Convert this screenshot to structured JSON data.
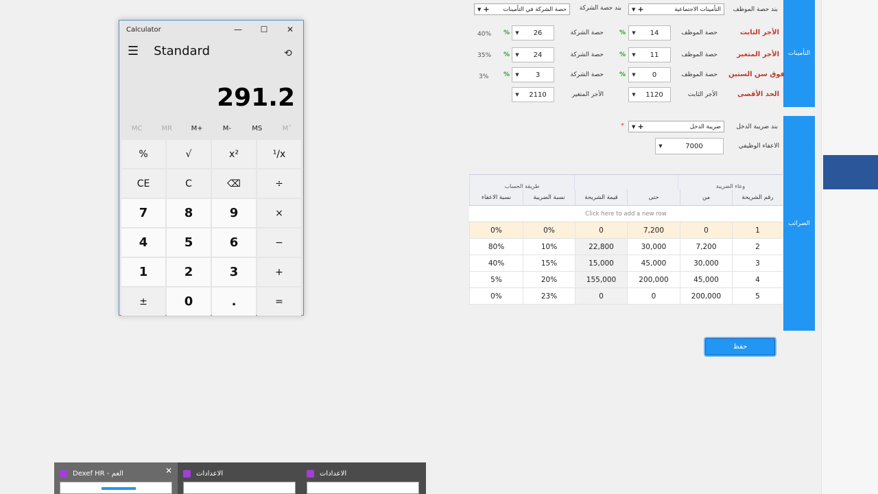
{
  "calculator": {
    "window_title": "Calculator",
    "mode": "Standard",
    "display": "291.2",
    "memory": [
      "MC",
      "MR",
      "M+",
      "M-",
      "MS",
      "M˅"
    ],
    "keys": [
      "%",
      "√",
      "x²",
      "¹/x",
      "CE",
      "C",
      "⌫",
      "÷",
      "7",
      "8",
      "9",
      "×",
      "4",
      "5",
      "6",
      "−",
      "1",
      "2",
      "3",
      "+",
      "±",
      "0",
      ".",
      "="
    ]
  },
  "insurance": {
    "section_label": "التأمينات",
    "employee_item_label": "بند حصة الموظف",
    "employee_item_value": "التأمينات الاجتماعية",
    "company_item_label": "بند حصة الشركة",
    "company_item_value": "حصة الشركة في التأمينات",
    "rows": [
      {
        "name": "الأجر الثابت",
        "emp_label": "حصة الموظف",
        "emp_value": "14",
        "comp_label": "حصة الشركة",
        "comp_value": "26",
        "pct_sign": "%",
        "total": "40%"
      },
      {
        "name": "الأجر المتغير",
        "emp_label": "حصة الموظف",
        "emp_value": "11",
        "comp_label": "حصة الشركة",
        "comp_value": "24",
        "pct_sign": "%",
        "total": "35%"
      },
      {
        "name": "فوق سن الستين",
        "emp_label": "حصة الموظف",
        "emp_value": "0",
        "comp_label": "حصة الشركة",
        "comp_value": "3",
        "pct_sign": "%",
        "total": "3%"
      }
    ],
    "max_row": {
      "name": "الحد الأقصى",
      "fixed_label": "الأجر الثابت",
      "fixed_value": "1120",
      "var_label": "الأجر المتغير",
      "var_value": "2110"
    }
  },
  "taxes": {
    "section_label": "الضرائب",
    "income_tax_item_label": "بند ضريبة الدخل",
    "income_tax_item_value": "ضريبة الدخل",
    "required_mark": "*",
    "job_exemption_label": "الاعفاء الوظيفي",
    "job_exemption_value": "7000",
    "grid": {
      "group_headers": {
        "tax_base": "وعاء الضريبة",
        "calc_method": "طريقة الحساب"
      },
      "columns": [
        "رقم الشريحة",
        "من",
        "حتى",
        "قيمة الشريحة",
        "نسبة الضريبة",
        "نسبة الاعفاء"
      ],
      "new_row_text": "Click here to add a new row",
      "rows": [
        [
          "1",
          "0",
          "7,200",
          "0",
          "0%",
          "0%"
        ],
        [
          "2",
          "7,200",
          "30,000",
          "22,800",
          "10%",
          "80%"
        ],
        [
          "3",
          "30,000",
          "45,000",
          "15,000",
          "15%",
          "40%"
        ],
        [
          "4",
          "45,000",
          "200,000",
          "155,000",
          "20%",
          "5%"
        ],
        [
          "5",
          "200,000",
          "0",
          "0",
          "23%",
          "0%"
        ]
      ]
    }
  },
  "save_button": "حفظ",
  "taskbar": [
    {
      "title": "Dexef HR - العم",
      "active": true
    },
    {
      "title": "الاعدادات",
      "active": false
    },
    {
      "title": "الاعدادات",
      "active": false
    }
  ]
}
